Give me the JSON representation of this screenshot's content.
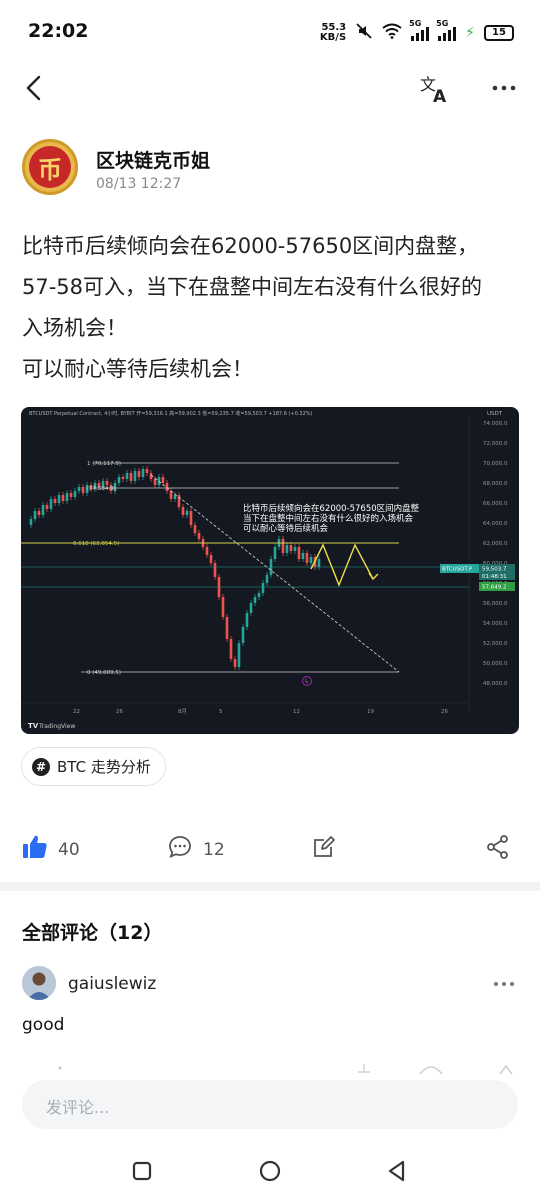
{
  "status_bar": {
    "time": "22:02",
    "net_speed_value": "55.3",
    "net_speed_unit": "KB/S",
    "sim1": "5G",
    "sim2": "5G",
    "battery": "15"
  },
  "header": {
    "back_icon": "back-arrow-icon",
    "translate_icon": "translate-icon",
    "more_icon": "more-horizontal-icon"
  },
  "post": {
    "author_name": "区块链克币姐",
    "avatar_char": "币",
    "time": "08/13 12:27",
    "lines": [
      "比特币后续倾向会在62000-57650区间内盘整，",
      "57-58可入，当下在盘整中间左右没有什么很好的",
      "入场机会！",
      "可以耐心等待后续机会！"
    ],
    "tag": "BTC 走势分析"
  },
  "chart": {
    "header_text": "BTCUSDT Perpetual Contract, 4小时, BYBIT  开=59,316.1  高=59,902.3  低=59,235.7  收=59,503.7  +187.6 (+0.32%)",
    "currency": "USDT",
    "annotation_lines": [
      "比特币后续倾向会在62000-57650区间内盘整",
      "当下在盘整中间左右没有什么很好的入场机会",
      "可以耐心等待后续机会"
    ],
    "fib_labels": [
      "1 (70,117.9)",
      "(67,584.9)",
      "0.618 (62,054.5)",
      "0 (49,009.5)"
    ],
    "price_ticks": [
      "74,000.0",
      "72,000.0",
      "70,000.0",
      "68,000.0",
      "66,000.0",
      "64,000.0",
      "62,000.0",
      "60,000.0",
      "58,000.0",
      "56,000.0",
      "54,000.0",
      "52,000.0",
      "50,000.0",
      "48,000.0"
    ],
    "date_ticks": [
      "22",
      "26",
      "8月",
      "5",
      "12",
      "19",
      "26"
    ],
    "symbol_badge": "BTCUSDT.P",
    "last_price": "59,503.7",
    "countdown": "01:48:31",
    "lower_price": "57,649.2",
    "brand": "TradingView"
  },
  "actions": {
    "like_count": "40",
    "comment_count": "12"
  },
  "comments": {
    "title": "全部评论（12）",
    "items": [
      {
        "user": "gaiuslewiz",
        "text": "good"
      }
    ]
  },
  "input": {
    "placeholder": "发评论..."
  },
  "colors": {
    "chart_bg": "#141820",
    "up": "#26a69a",
    "down": "#ef5350",
    "fib": "#d4d44a",
    "like_blue": "#2a6df4"
  }
}
